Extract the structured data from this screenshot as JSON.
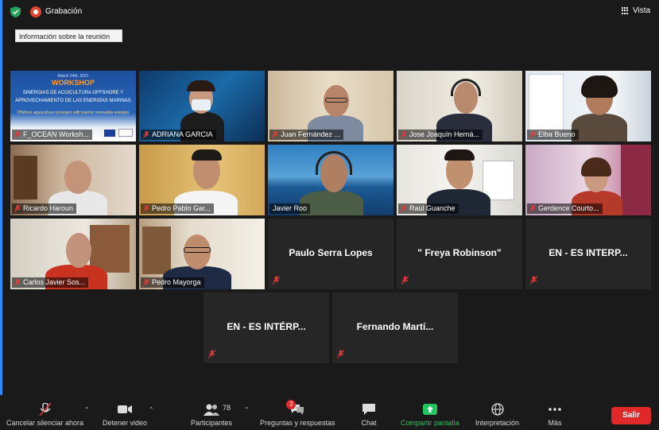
{
  "top_bar": {
    "recording_label": "Grabación",
    "view_label": "Vista",
    "meeting_info_tooltip": "Información sobre la reunión"
  },
  "participants": [
    {
      "name": "F_OCEAN Worksh...",
      "muted": true
    },
    {
      "name": "ADRIANA GARCIA",
      "muted": true
    },
    {
      "name": "Juan Fernández ...",
      "muted": true
    },
    {
      "name": "Jose Joaquín Herná...",
      "muted": true,
      "active_speaker": true
    },
    {
      "name": "Elba Bueno",
      "muted": true
    },
    {
      "name": "Ricardo Haroun",
      "muted": true
    },
    {
      "name": "Pedro Pablo Gar...",
      "muted": true
    },
    {
      "name": "Javier Roo",
      "muted": false
    },
    {
      "name": "Raúl Guanche",
      "muted": true
    },
    {
      "name": "Gerdence Courto...",
      "muted": true
    },
    {
      "name": "Carlos Javier Sos...",
      "muted": true
    },
    {
      "name": "Pedro Mayorga",
      "muted": true
    },
    {
      "name": "Paulo Serra Lopes",
      "muted": true,
      "video_off": true
    },
    {
      "name": "\" Freya Robinson\"",
      "muted": true,
      "video_off": true
    },
    {
      "name": "EN - ES INTERP...",
      "muted": true,
      "video_off": true
    },
    {
      "name": "EN - ES INTÉRP...",
      "muted": true,
      "video_off": true
    },
    {
      "name": "Fernando  Martí...",
      "muted": true,
      "video_off": true
    }
  ],
  "slide": {
    "date": "March 24th, 2021",
    "heading": "WORKSHOP",
    "line1": "SINERGIAS DE ACUICULTURA OFFSHORE Y",
    "line2": "APROVECHAMIENTO DE LAS ENERGÍAS MARINAS",
    "line3": "Offshore aquaculture synergies with marine renewable energies"
  },
  "toolbar": {
    "mute_label": "Cancelar silenciar ahora",
    "video_label": "Detener video",
    "participants_label": "Participantes",
    "participants_count": "78",
    "qa_label": "Preguntas y respuestas",
    "qa_badge": "3",
    "chat_label": "Chat",
    "share_label": "Compartir pantalla",
    "interpretation_label": "Interpretación",
    "more_label": "Más",
    "exit_label": "Salir"
  },
  "colors": {
    "active_speaker_border": "#c8e04a",
    "exit_button": "#e02828",
    "share_icon": "#22c55e",
    "recording_dot": "#e0442f"
  }
}
